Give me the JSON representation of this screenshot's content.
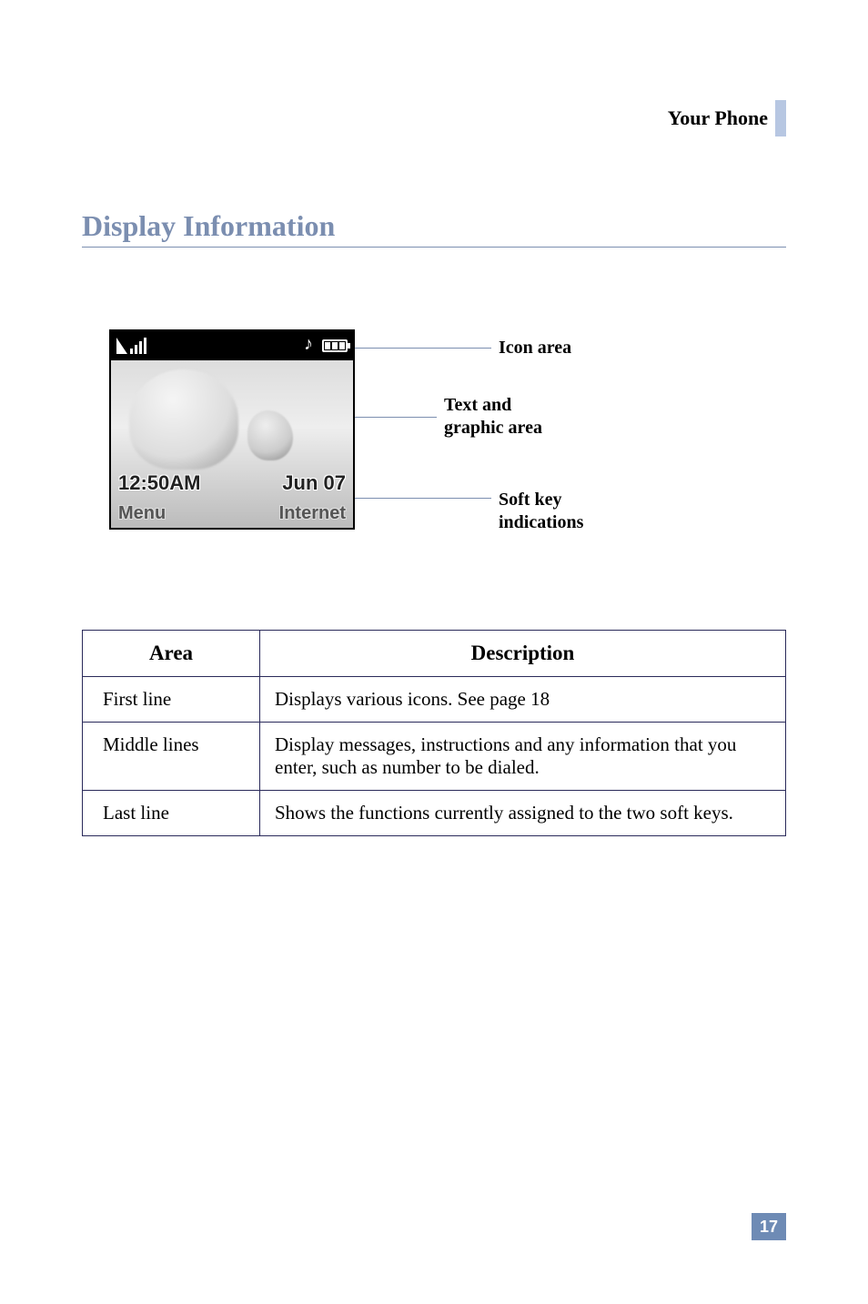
{
  "header": {
    "chapter": "Your Phone"
  },
  "section": {
    "title": "Display Information"
  },
  "figure": {
    "screen": {
      "time": "12:50AM",
      "date": "Jun 07",
      "softkey_left": "Menu",
      "softkey_right": "Internet"
    },
    "callouts": {
      "icon_area": "Icon area",
      "text_area_l1": "Text and",
      "text_area_l2": "graphic area",
      "soft_l1": "Soft key",
      "soft_l2": "indications"
    }
  },
  "table": {
    "headers": {
      "area": "Area",
      "description": "Description"
    },
    "rows": [
      {
        "area": "First line",
        "desc": "Displays various icons. See page 18"
      },
      {
        "area": "Middle lines",
        "desc": "Display messages, instructions and any information that you enter, such as number to be dialed."
      },
      {
        "area": "Last line",
        "desc": "Shows the functions currently assigned to the two soft keys."
      }
    ]
  },
  "page_number": "17"
}
